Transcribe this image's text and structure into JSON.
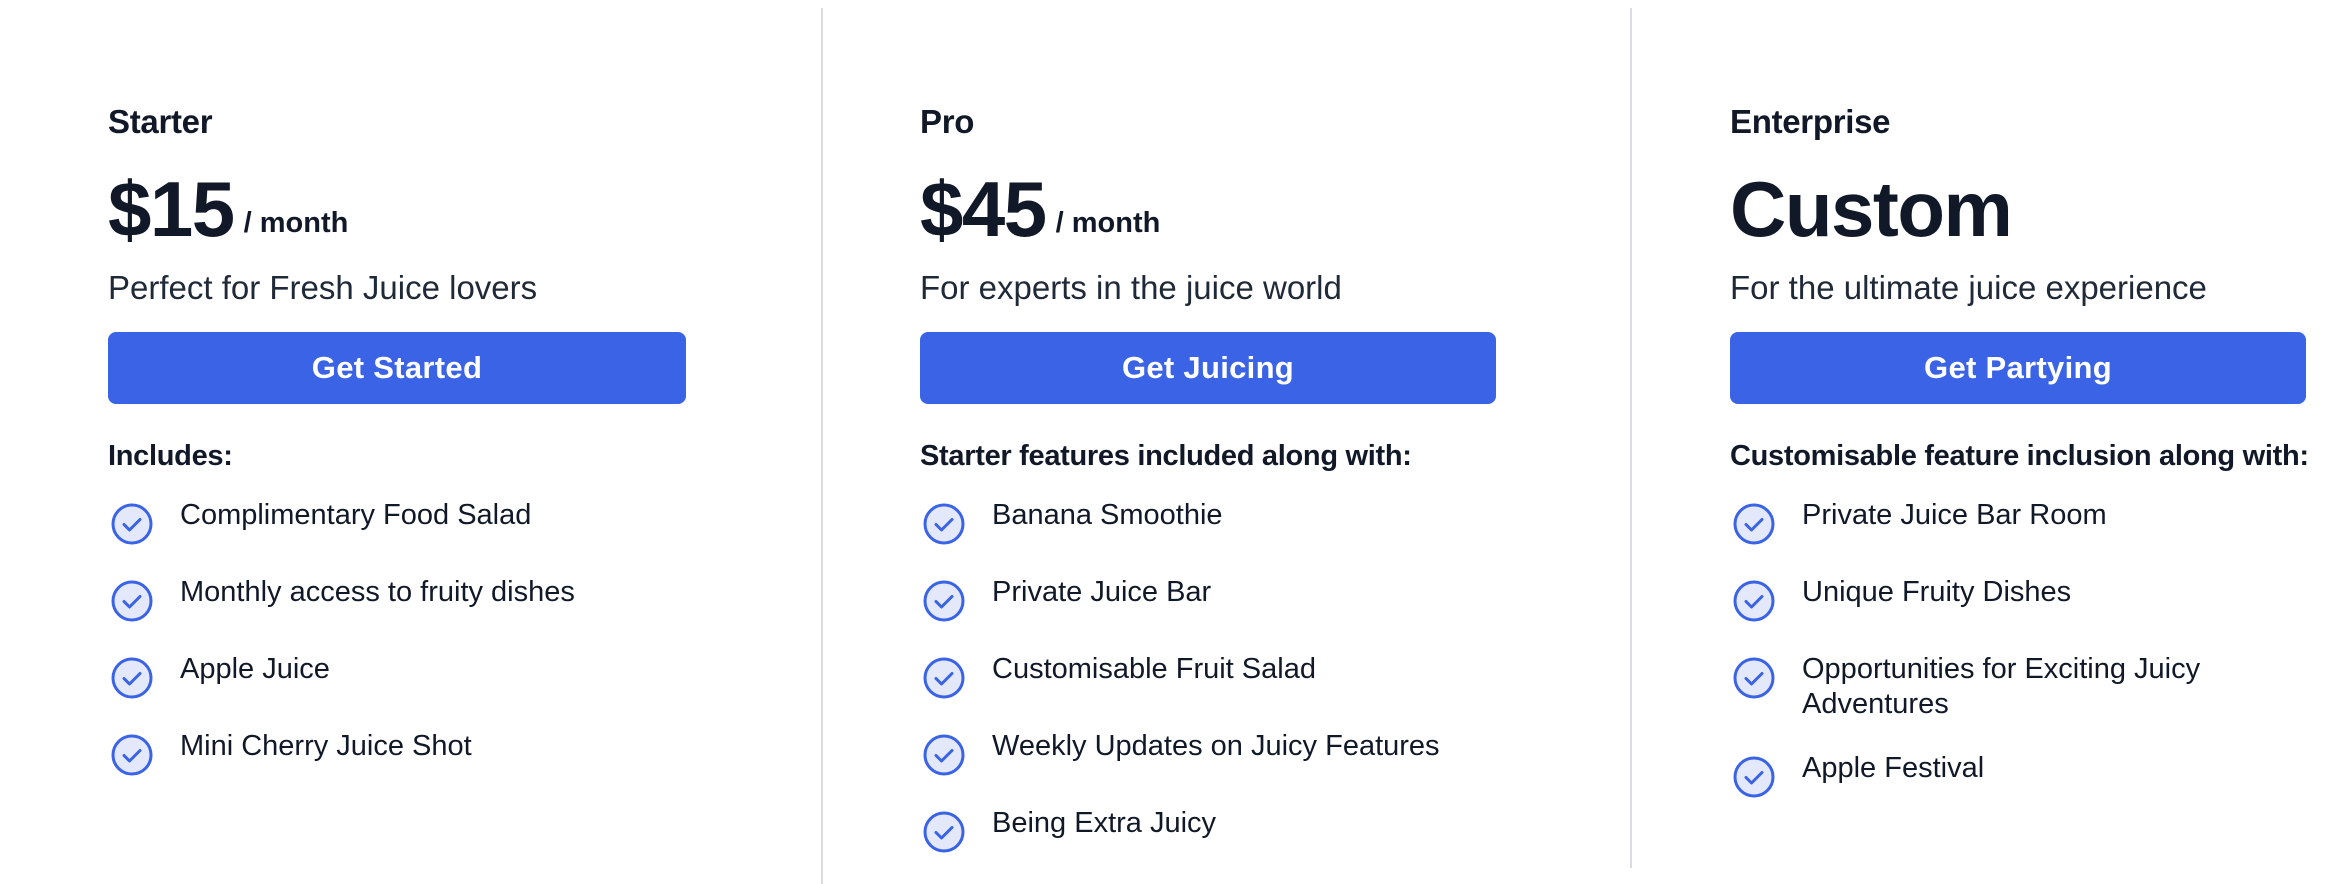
{
  "colors": {
    "accent": "#3a63e6",
    "check_fill": "#e3e8fb",
    "divider": "#d9dbe0",
    "text": "#111827"
  },
  "plans": [
    {
      "name": "Starter",
      "price": "$15",
      "period": "/ month",
      "tagline": "Perfect for Fresh Juice lovers",
      "cta": "Get Started",
      "includes_label": "Includes:",
      "features": [
        "Complimentary Food Salad",
        "Monthly access to fruity dishes",
        "Apple Juice",
        "Mini Cherry Juice Shot"
      ]
    },
    {
      "name": "Pro",
      "price": "$45",
      "period": "/ month",
      "tagline": "For experts in the juice world",
      "cta": "Get Juicing",
      "includes_label": "Starter features included along with:",
      "features": [
        "Banana Smoothie",
        "Private Juice Bar",
        "Customisable Fruit Salad",
        "Weekly Updates on Juicy Features",
        "Being Extra Juicy"
      ]
    },
    {
      "name": "Enterprise",
      "price": "Custom",
      "period": "",
      "tagline": "For the ultimate juice experience",
      "cta": "Get Partying",
      "includes_label": "Customisable feature inclusion along with:",
      "features": [
        "Private Juice Bar Room",
        "Unique Fruity Dishes",
        "Opportunities for Exciting Juicy Adventures",
        "Apple Festival"
      ]
    }
  ],
  "icons": {
    "feature_icon": "check-circle-icon"
  }
}
